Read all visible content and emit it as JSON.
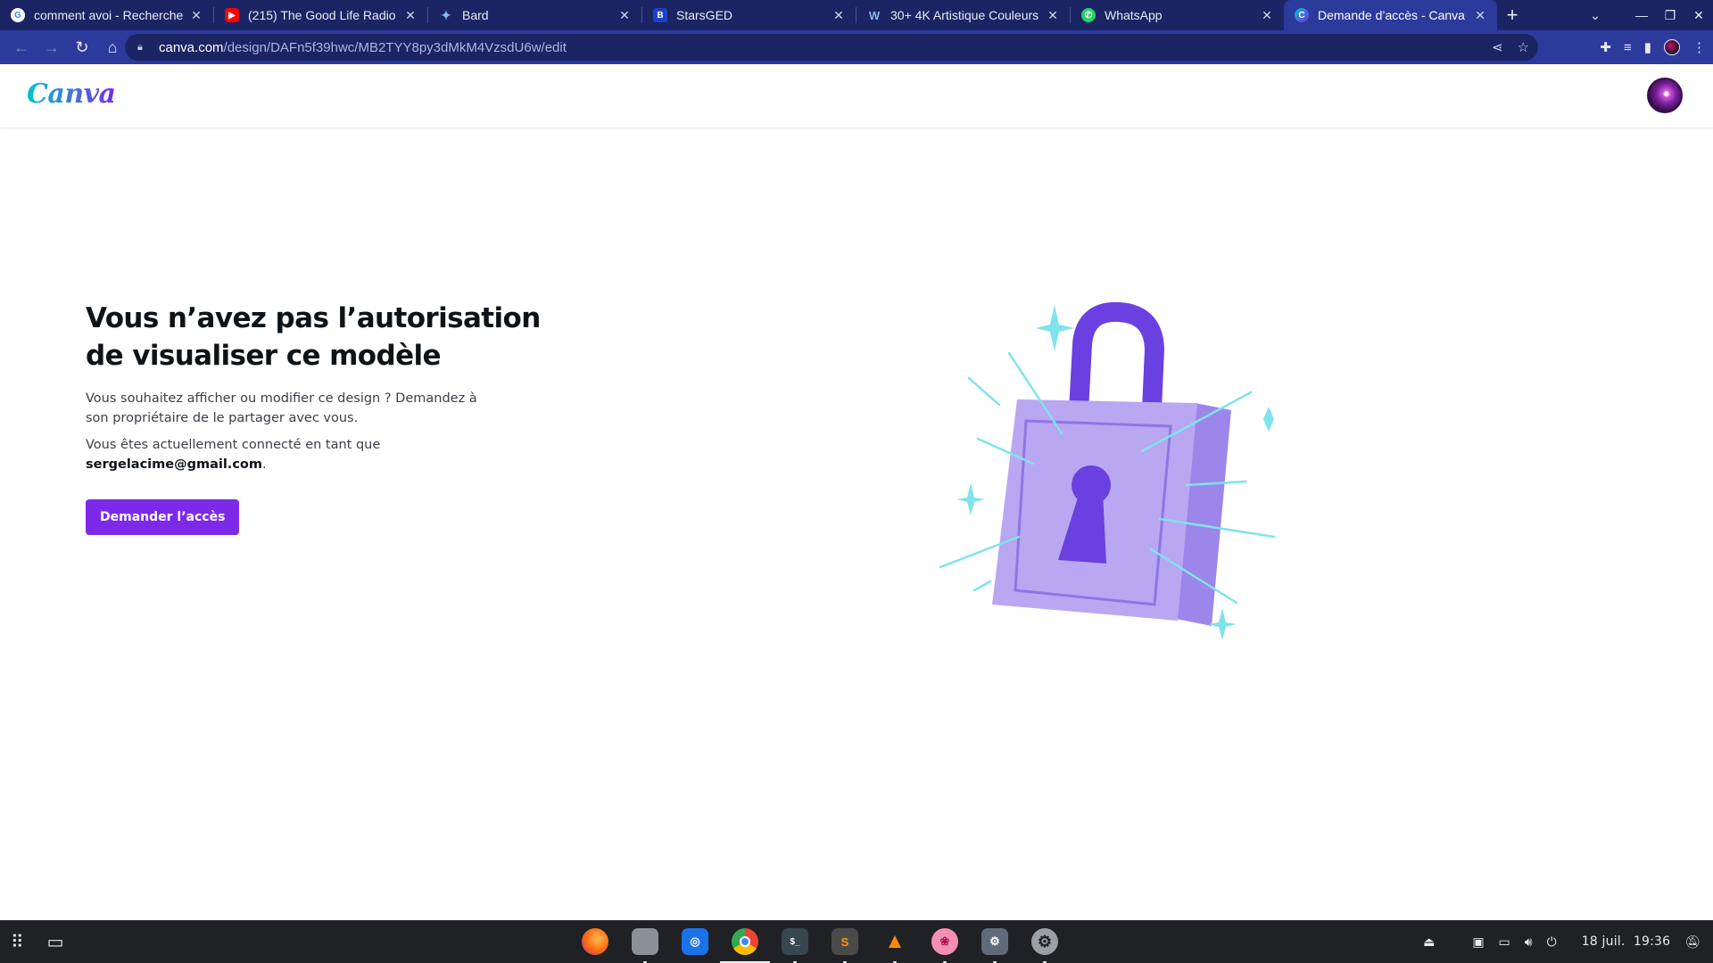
{
  "browser": {
    "tabs": [
      {
        "title": "comment avoi - Recherche",
        "favicon": "google-icon",
        "active": false
      },
      {
        "title": "(215) The Good Life Radio",
        "favicon": "youtube-icon",
        "active": false
      },
      {
        "title": "Bard",
        "favicon": "bard-sparkle-icon",
        "active": false
      },
      {
        "title": "StarsGED",
        "favicon": "starsged-icon",
        "active": false
      },
      {
        "title": "30+ 4K Artistique Couleurs",
        "favicon": "wallpaper-site-icon",
        "active": false
      },
      {
        "title": "WhatsApp",
        "favicon": "whatsapp-icon",
        "active": false
      },
      {
        "title": "Demande d’accès - Canva",
        "favicon": "canva-icon",
        "active": true
      }
    ],
    "url": {
      "domain": "canva.com",
      "path": "/design/DAFn5f39hwc/MB2TYY8py3dMkM4VzsdU6w/edit"
    }
  },
  "canva": {
    "logo": "Canva",
    "headline_line1": "Vous n’avez pas l’autorisation",
    "headline_line2": "de visualiser ce modèle",
    "paragraph1": "Vous souhaitez afficher ou modifier ce design ? Demandez à son propriétaire de le partager avec vous.",
    "paragraph2_prefix": "Vous êtes actuellement connecté en tant que",
    "email": "sergelacime@gmail.com",
    "paragraph2_suffix": ".",
    "cta_label": "Demander l’accès",
    "colors": {
      "brand_purple": "#7d2ae8",
      "lock_body": "#b9a7f1",
      "lock_side": "#9d86ea",
      "lock_shackle": "#6a40e0",
      "sparkle": "#7fe3ec"
    }
  },
  "taskbar": {
    "apps": [
      "firefox-icon",
      "files-icon",
      "web-store-icon",
      "chrome-icon",
      "terminal-icon",
      "sublime-text-icon",
      "vlc-icon",
      "brain-app-icon",
      "settings-gear-app-icon",
      "system-settings-icon"
    ],
    "date": "18 juil.",
    "time": "19:36"
  }
}
